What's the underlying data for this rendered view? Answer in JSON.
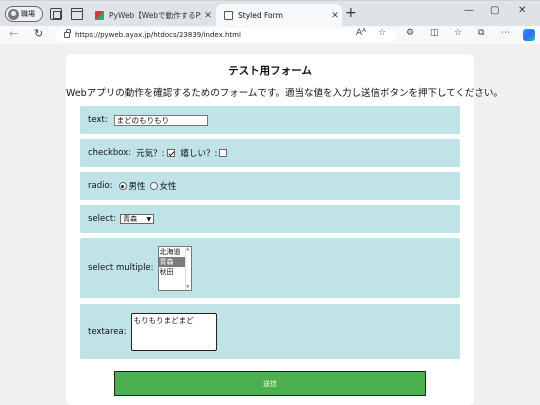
{
  "browser": {
    "profile_label": "職場",
    "tabs": [
      {
        "title": "PyWeb【Webで動作するPython実",
        "active": false
      },
      {
        "title": "Styled Form",
        "active": true
      }
    ],
    "new_tab": "+",
    "window_controls": {
      "minimize": "—",
      "maximize": "▢",
      "close": "✕"
    },
    "url": "https://pyweb.ayax.jp/htdocs/23839/index.html"
  },
  "page": {
    "title": "テスト用フォーム",
    "description": "Webアプリの動作を確認するためのフォームです。適当な値を入力し送信ボタンを押下してください。",
    "text": {
      "label": "text:",
      "value": "まどのもりもり"
    },
    "checkbox": {
      "label": "checkbox:",
      "items": [
        {
          "label": "元気？:",
          "checked": true
        },
        {
          "label": "嬉しい？:",
          "checked": false
        }
      ]
    },
    "radio": {
      "label": "radio:",
      "options": [
        {
          "label": "男性",
          "checked": true
        },
        {
          "label": "女性",
          "checked": false
        }
      ]
    },
    "select": {
      "label": "select:",
      "value": "青森"
    },
    "select_multiple": {
      "label": "select multiple:",
      "options": [
        "北海道",
        "青森",
        "秋田"
      ],
      "selected": [
        "青森"
      ]
    },
    "textarea": {
      "label": "textarea:",
      "value": "もりもりまどまど"
    },
    "submit_label": "送信"
  }
}
